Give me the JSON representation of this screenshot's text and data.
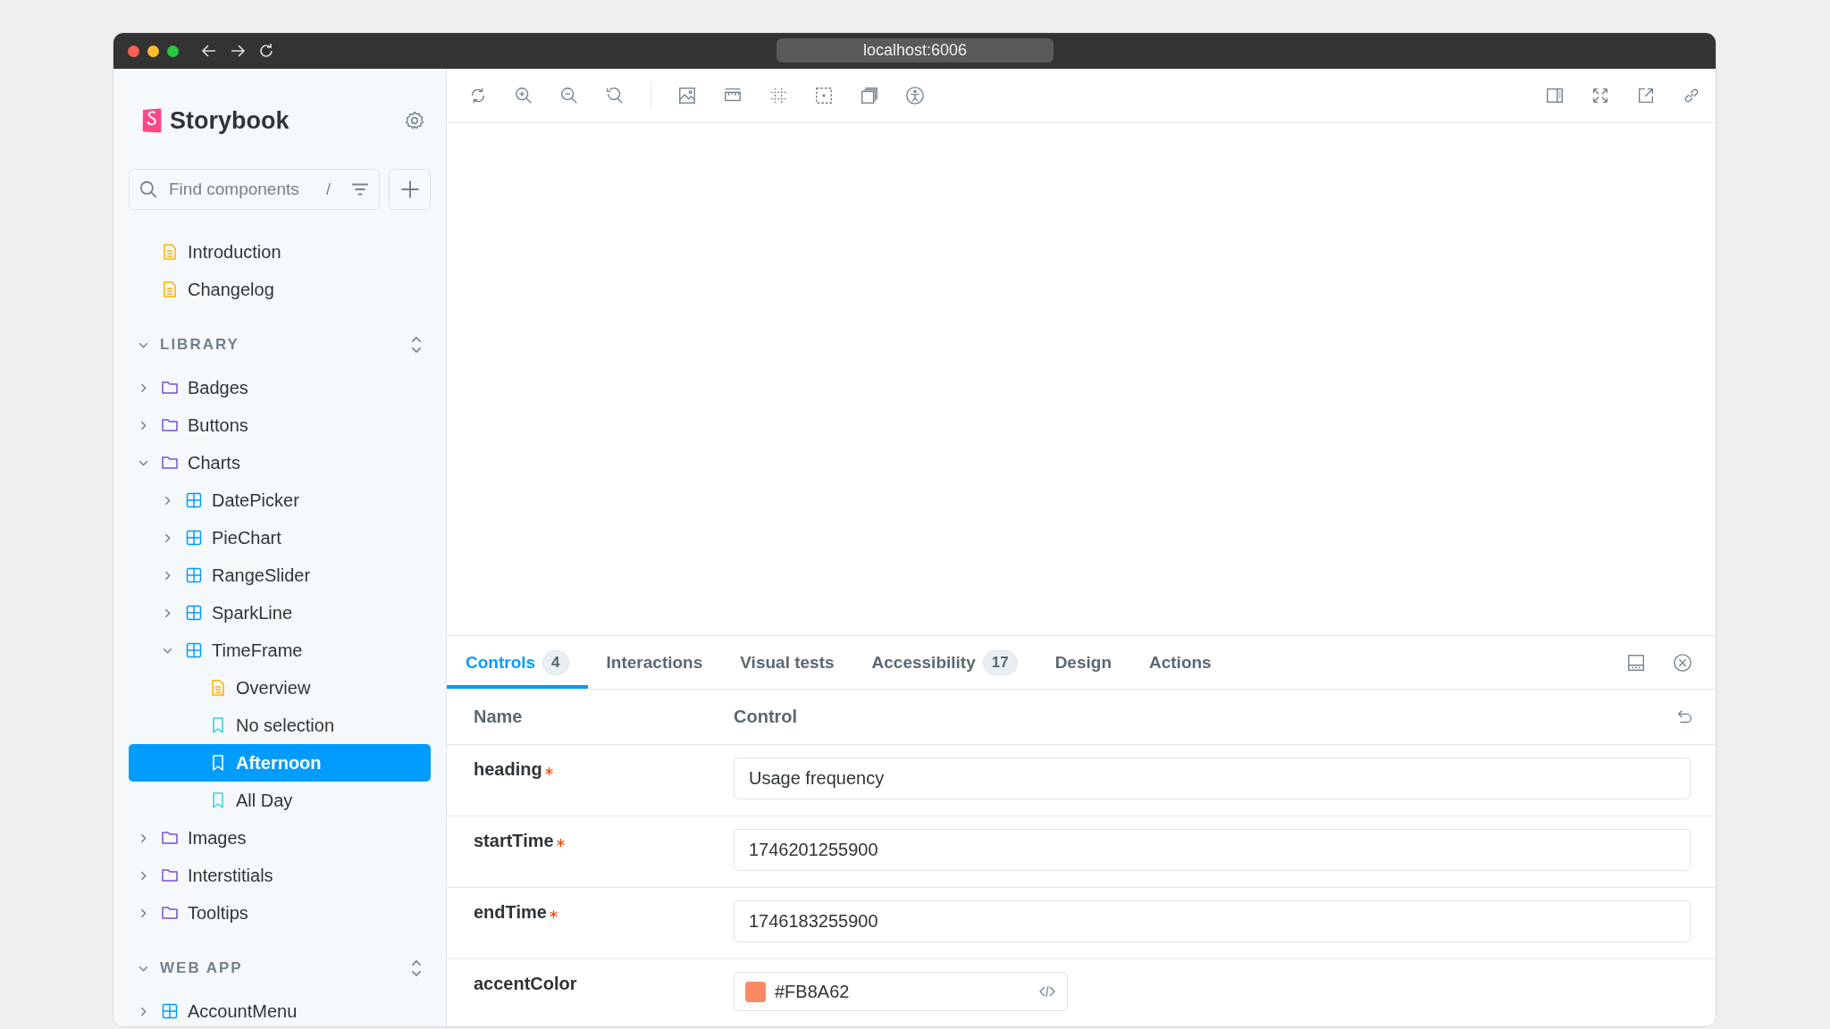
{
  "browser": {
    "address": "localhost:6006"
  },
  "sidebar": {
    "brand": "Storybook",
    "search": {
      "placeholder": "Find components",
      "shortcut": "/"
    },
    "items": [
      {
        "kind": "doc",
        "label": "Introduction",
        "selected": false
      },
      {
        "kind": "doc",
        "label": "Changelog",
        "selected": false
      }
    ],
    "sections": [
      {
        "title": "LIBRARY",
        "expanded": true,
        "items": [
          {
            "kind": "folder",
            "label": "Badges",
            "expanded": false,
            "selected": false
          },
          {
            "kind": "folder",
            "label": "Buttons",
            "expanded": false,
            "selected": false
          },
          {
            "kind": "folder",
            "label": "Charts",
            "expanded": true,
            "selected": false,
            "children": [
              {
                "kind": "component",
                "label": "DatePicker",
                "expanded": false,
                "selected": false
              },
              {
                "kind": "component",
                "label": "PieChart",
                "expanded": false,
                "selected": false
              },
              {
                "kind": "component",
                "label": "RangeSlider",
                "expanded": false,
                "selected": false
              },
              {
                "kind": "component",
                "label": "SparkLine",
                "expanded": false,
                "selected": false
              },
              {
                "kind": "component",
                "label": "TimeFrame",
                "expanded": true,
                "selected": false,
                "children": [
                  {
                    "kind": "doc",
                    "label": "Overview",
                    "selected": false
                  },
                  {
                    "kind": "story",
                    "label": "No selection",
                    "selected": false
                  },
                  {
                    "kind": "story",
                    "label": "Afternoon",
                    "selected": true
                  },
                  {
                    "kind": "story",
                    "label": "All Day",
                    "selected": false
                  }
                ]
              }
            ]
          },
          {
            "kind": "folder",
            "label": "Images",
            "expanded": false,
            "selected": false
          },
          {
            "kind": "folder",
            "label": "Interstitials",
            "expanded": false,
            "selected": false
          },
          {
            "kind": "folder",
            "label": "Tooltips",
            "expanded": false,
            "selected": false
          }
        ]
      },
      {
        "title": "WEB APP",
        "expanded": true,
        "items": [
          {
            "kind": "component",
            "label": "AccountMenu",
            "expanded": false,
            "selected": false
          }
        ]
      }
    ]
  },
  "panel": {
    "tabs": [
      {
        "label": "Controls",
        "count": "4",
        "selected": true
      },
      {
        "label": "Interactions",
        "selected": false
      },
      {
        "label": "Visual tests",
        "selected": false
      },
      {
        "label": "Accessibility",
        "count": "17",
        "selected": false
      },
      {
        "label": "Design",
        "selected": false
      },
      {
        "label": "Actions",
        "selected": false
      }
    ],
    "columns": [
      "Name",
      "Control"
    ],
    "rows": [
      {
        "name": "heading",
        "required": true,
        "kind": "text",
        "value": "Usage frequency"
      },
      {
        "name": "startTime",
        "required": true,
        "kind": "text",
        "value": "1746201255900"
      },
      {
        "name": "endTime",
        "required": true,
        "kind": "text",
        "value": "1746183255900"
      },
      {
        "name": "accentColor",
        "required": false,
        "kind": "color",
        "value": "#FB8A62",
        "color": "#fb8a62"
      }
    ]
  }
}
